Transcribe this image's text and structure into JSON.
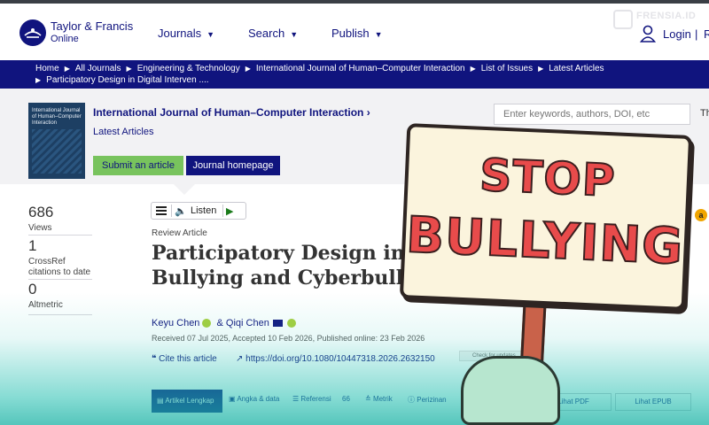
{
  "watermark": "FRENSIA.ID",
  "header": {
    "brand_name": "Taylor & Francis",
    "brand_sub": "Online",
    "nav": [
      {
        "label": "Journals"
      },
      {
        "label": "Search"
      },
      {
        "label": "Publish"
      }
    ],
    "login_label": "Login",
    "login_sep": "|",
    "login_more": "R"
  },
  "breadcrumb": {
    "items": [
      "Home",
      "All Journals",
      "Engineering & Technology",
      "International Journal of Human–Computer Interaction",
      "List of Issues",
      "Latest Articles"
    ],
    "current": "Participatory Design in Digital Interven ...."
  },
  "journal": {
    "cover_title": "International Journal of Human–Computer Interaction",
    "title": "International Journal of Human–Computer Interaction",
    "title_chevron": "›",
    "latest": "Latest Articles",
    "submit_label": "Submit an article",
    "homepage_label": "Journal homepage"
  },
  "search": {
    "placeholder": "Enter keywords, authors, DOI, etc",
    "more": "Th"
  },
  "listen": {
    "label": "Listen"
  },
  "metrics": [
    {
      "value": "686",
      "label": "Views"
    },
    {
      "value": "1",
      "label": "CrossRef citations to date"
    },
    {
      "value": "0",
      "label": "Altmetric"
    }
  ],
  "article": {
    "type": "Review Article",
    "title_line1": "Participatory Design in D",
    "title_line2": "Bullying and Cyberbullying: A Sys",
    "author1": "Keyu Chen",
    "author_sep": "&",
    "author2": "Qiqi Chen",
    "received": "Received 07 Jul 2025, Accepted 10 Feb 2026, Published online: 23 Feb 2026",
    "cite_label": "Cite this article",
    "doi": "https://doi.org/10.1080/10447318.2026.2632150",
    "check_updates": "Check for updates"
  },
  "tabs": {
    "active": "Artikel Lengkap",
    "items": [
      "Angka & data",
      "Referensi",
      "66",
      "Metrik",
      "Perizinan"
    ],
    "pdf": "Lihat PDF",
    "epub": "Lihat EPUB"
  },
  "sign": {
    "line1": "STOP",
    "line2": "BULLYING"
  },
  "colors": {
    "brand": "#10147e",
    "submit": "#78c35d",
    "sign_text": "#e84b4b",
    "teal": "#20beaf"
  }
}
